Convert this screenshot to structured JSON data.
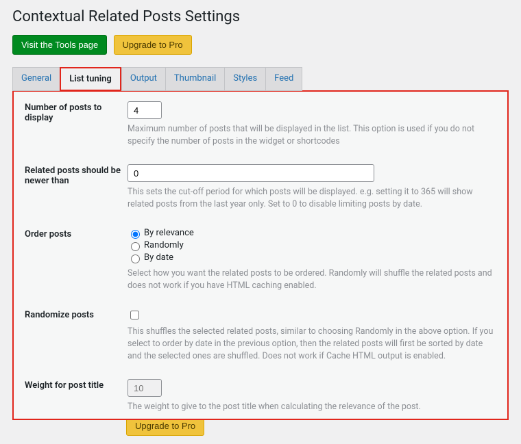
{
  "page_title": "Contextual Related Posts Settings",
  "top_buttons": {
    "visit_tools": "Visit the Tools page",
    "upgrade": "Upgrade to Pro"
  },
  "tabs": [
    "General",
    "List tuning",
    "Output",
    "Thumbnail",
    "Styles",
    "Feed"
  ],
  "active_tab": 1,
  "fields": {
    "num_posts": {
      "label": "Number of posts to display",
      "value": "4",
      "desc": "Maximum number of posts that will be displayed in the list. This option is used if you do not specify the number of posts in the widget or shortcodes"
    },
    "newer_than": {
      "label": "Related posts should be newer than",
      "value": "0",
      "desc": "This sets the cut-off period for which posts will be displayed. e.g. setting it to 365 will show related posts from the last year only. Set to 0 to disable limiting posts by date."
    },
    "order": {
      "label": "Order posts",
      "options": [
        "By relevance",
        "Randomly",
        "By date"
      ],
      "desc": "Select how you want the related posts to be ordered. Randomly will shuffle the related posts and does not work if you have HTML caching enabled."
    },
    "randomize": {
      "label": "Randomize posts",
      "desc": "This shuffles the selected related posts, similar to choosing Randomly in the above option. If you select to order by date in the previous option, then the related posts will first be sorted by date and the selected ones are shuffled. Does not work if Cache HTML output is enabled."
    },
    "weight_title": {
      "label": "Weight for post title",
      "placeholder": "10",
      "desc": "The weight to give to the post title when calculating the relevance of the post."
    }
  },
  "bottom_upgrade": "Upgrade to Pro"
}
